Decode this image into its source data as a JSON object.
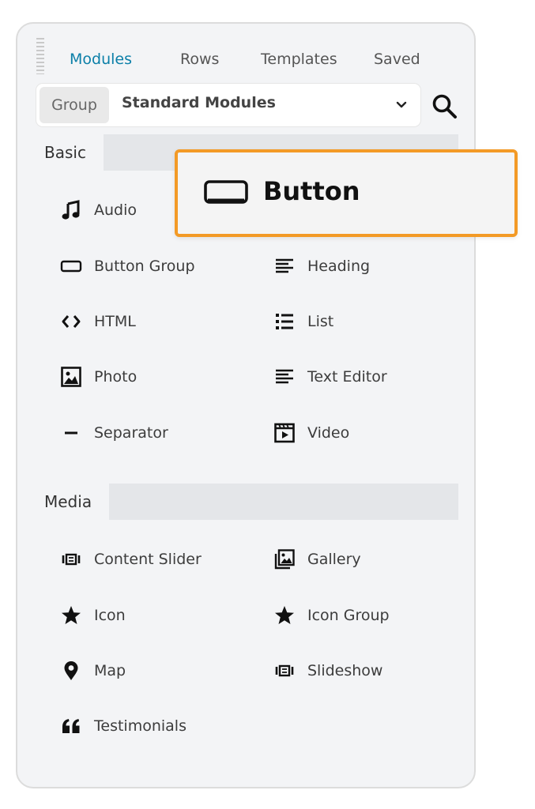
{
  "tabs": [
    {
      "label": "Modules",
      "active": true
    },
    {
      "label": "Rows",
      "active": false
    },
    {
      "label": "Templates",
      "active": false
    },
    {
      "label": "Saved",
      "active": false
    }
  ],
  "group_select": {
    "label": "Group",
    "value": "Standard Modules",
    "icon": "chevron-down-icon"
  },
  "search": {
    "icon": "search-icon"
  },
  "colors": {
    "accent": "#0b7fa8",
    "drag_border": "#f39a26",
    "panel_bg": "#f3f4f6",
    "section_bg": "#e4e6e9"
  },
  "sections": [
    {
      "title": "Basic",
      "items": [
        {
          "label": "Audio",
          "icon": "music-note-icon"
        },
        {
          "label": "Button Group",
          "icon": "button-icon"
        },
        {
          "label": "Heading",
          "icon": "heading-icon"
        },
        {
          "label": "HTML",
          "icon": "code-icon"
        },
        {
          "label": "List",
          "icon": "list-icon"
        },
        {
          "label": "Photo",
          "icon": "photo-icon"
        },
        {
          "label": "Text Editor",
          "icon": "text-editor-icon"
        },
        {
          "label": "Separator",
          "icon": "separator-icon"
        },
        {
          "label": "Video",
          "icon": "video-icon"
        }
      ]
    },
    {
      "title": "Media",
      "items": [
        {
          "label": "Content Slider",
          "icon": "slider-icon"
        },
        {
          "label": "Gallery",
          "icon": "gallery-icon"
        },
        {
          "label": "Icon",
          "icon": "star-icon"
        },
        {
          "label": "Icon Group",
          "icon": "star-icon"
        },
        {
          "label": "Map",
          "icon": "map-pin-icon"
        },
        {
          "label": "Slideshow",
          "icon": "slider-icon"
        },
        {
          "label": "Testimonials",
          "icon": "quote-icon"
        }
      ]
    }
  ],
  "dragging": {
    "label": "Button",
    "icon": "button-icon"
  }
}
